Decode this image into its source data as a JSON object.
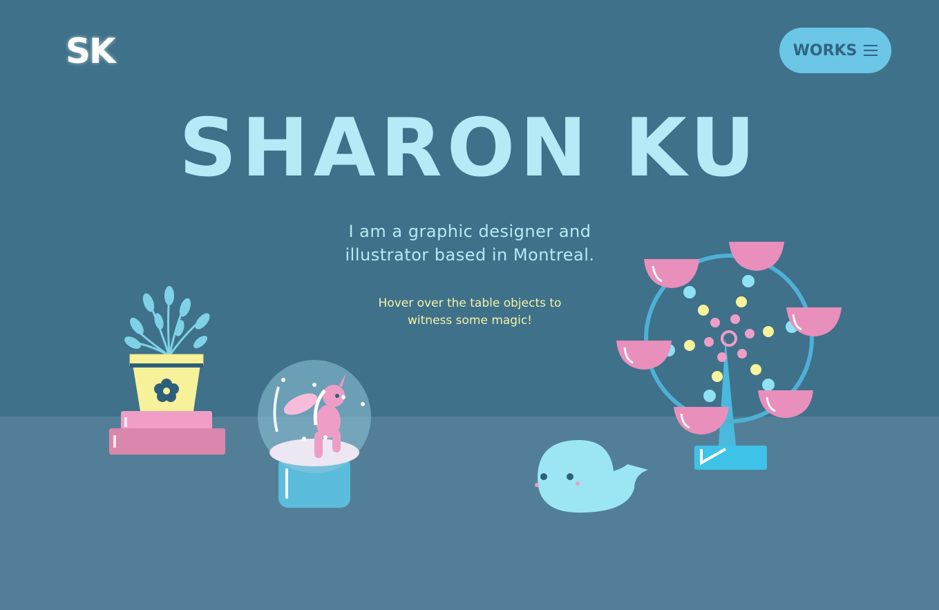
{
  "header": {
    "logo_text": "SK",
    "menu_button_label": "WORKS",
    "menu_icon": "hamburger-icon"
  },
  "hero": {
    "title": "SHARON KU",
    "intro_line1": "I am a graphic designer and",
    "intro_line2": "illustrator based in Montreal.",
    "hint_line1": "Hover over the table objects to",
    "hint_line2": "witness some magic!"
  },
  "table_objects": [
    {
      "name": "plant-on-books"
    },
    {
      "name": "unicorn-snow-globe"
    },
    {
      "name": "whale"
    },
    {
      "name": "ferris-wheel"
    }
  ],
  "colors": {
    "background": "#3f718a",
    "table": "#527f97",
    "title": "#b5eaf6",
    "hint": "#f5f3a6",
    "button": "#6cc6e6",
    "pink": "#ee9ec6",
    "yellow": "#f8f39a"
  }
}
